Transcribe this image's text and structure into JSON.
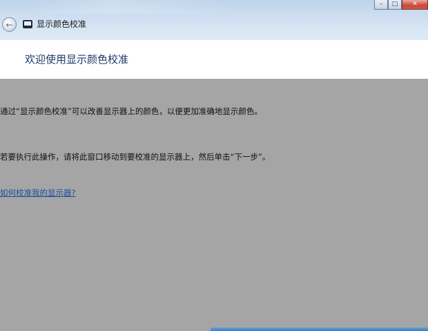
{
  "window": {
    "title": "显示颜色校准",
    "caption": {
      "minimize": "–",
      "maximize": "□",
      "close": "✕"
    }
  },
  "header": {
    "title": "欢迎使用显示颜色校准"
  },
  "main": {
    "paragraph1": "通过“显示颜色校准”可以改善显示器上的颜色，以便更加准确地显示颜色。",
    "paragraph2": "若要执行此操作，请将此窗口移动到要校准的显示器上，然后单击“下一步”。",
    "help_link": "如何校准我的显示器?"
  },
  "icons": {
    "back": "back-arrow-icon",
    "app": "monitor-icon"
  },
  "colors": {
    "content_bg": "#a5a5a5",
    "header_title": "#1e3a6a",
    "link": "#1b4f9c"
  }
}
